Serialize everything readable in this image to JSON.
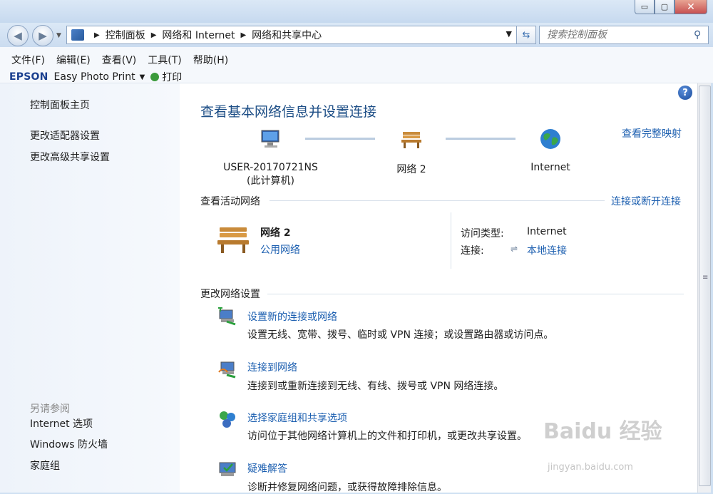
{
  "window": {
    "minimize": "▭",
    "maximize": "▢",
    "close": "✕"
  },
  "address": {
    "breadcrumbs": [
      "控制面板",
      "网络和 Internet",
      "网络和共享中心"
    ],
    "search_placeholder": "搜索控制面板"
  },
  "menu": [
    "文件(F)",
    "编辑(E)",
    "查看(V)",
    "工具(T)",
    "帮助(H)"
  ],
  "toolbar": {
    "brand": "EPSON",
    "app": "Easy Photo Print",
    "print": "打印"
  },
  "sidebar": {
    "home": "控制面板主页",
    "links": [
      "更改适配器设置",
      "更改高级共享设置"
    ],
    "see_also": "另请参阅",
    "see_also_links": [
      "Internet 选项",
      "Windows 防火墙",
      "家庭组"
    ]
  },
  "main": {
    "title": "查看基本网络信息并设置连接",
    "full_map": "查看完整映射",
    "nodes": [
      {
        "line1": "USER-20170721NS",
        "line2": "(此计算机)"
      },
      {
        "line1": "网络  2",
        "line2": ""
      },
      {
        "line1": "Internet",
        "line2": ""
      }
    ],
    "active_title": "查看活动网络",
    "connect_link": "连接或断开连接",
    "network_name": "网络  2",
    "network_type": "公用网络",
    "access_label": "访问类型:",
    "access_value": "Internet",
    "conn_label": "连接:",
    "conn_value": "本地连接",
    "change_title": "更改网络设置",
    "tasks": [
      {
        "title": "设置新的连接或网络",
        "desc": "设置无线、宽带、拨号、临时或 VPN 连接；或设置路由器或访问点。"
      },
      {
        "title": "连接到网络",
        "desc": "连接到或重新连接到无线、有线、拨号或 VPN 网络连接。"
      },
      {
        "title": "选择家庭组和共享选项",
        "desc": "访问位于其他网络计算机上的文件和打印机，或更改共享设置。"
      },
      {
        "title": "疑难解答",
        "desc": "诊断并修复网络问题，或获得故障排除信息。"
      }
    ]
  },
  "watermark": {
    "main": "Baidu 经验",
    "sub": "jingyan.baidu.com"
  }
}
